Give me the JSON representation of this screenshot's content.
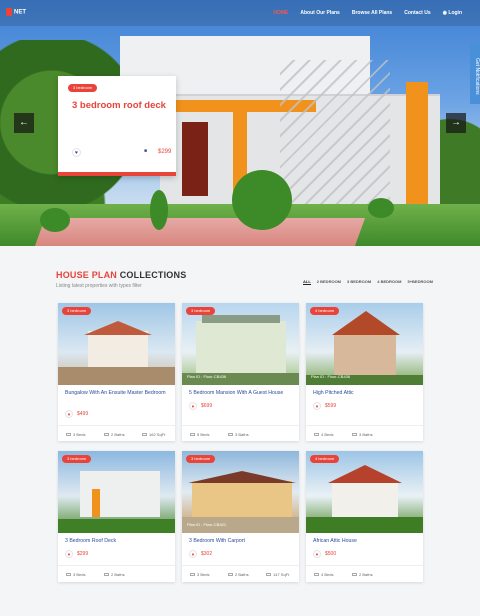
{
  "nav": {
    "logo": "NET",
    "links": [
      "HOME",
      "About Our Plans",
      "Browse All Plans",
      "Contact Us",
      "Login"
    ]
  },
  "side_tab": "Get Notifications",
  "hero": {
    "badge": "3 bedroom",
    "title": "3 bedroom roof deck",
    "price": "$299"
  },
  "section": {
    "title_red": "HOUSE PLAN",
    "title_rest": " COLLECTIONS",
    "subtitle": "Listing latest properties with types filter",
    "filters": [
      "ALL",
      "2 BEDROOM",
      "3 BEDROOM",
      "4 BEDROOM",
      "5+BEDROOM"
    ]
  },
  "cards": [
    {
      "badge": "3 bedroom",
      "plan_id": "",
      "title": "Bungalow With An Ensuite Master Bedroom",
      "price": "$499",
      "beds": "3 Beds",
      "baths": "2 Baths",
      "area": "162 SqFt"
    },
    {
      "badge": "3 bedroom",
      "plan_id": "Plan ID : Floor-CB436",
      "title": "5 Bedroom Mansion With A Guest House",
      "price": "$699",
      "beds": "5 Beds",
      "baths": "3 Baths",
      "area": ""
    },
    {
      "badge": "4 bedroom",
      "plan_id": "Plan ID : Floor-CB436",
      "title": "High Pitched Attic",
      "price": "$599",
      "beds": "4 Beds",
      "baths": "3 Baths",
      "area": ""
    },
    {
      "badge": "3 bedroom",
      "plan_id": "",
      "title": "3 Bedroom Roof Deck",
      "price": "$299",
      "beds": "3 Beds",
      "baths": "2 Baths",
      "area": ""
    },
    {
      "badge": "3 bedroom",
      "plan_id": "Plan ID : Floor-CB421",
      "title": "3 Bedroom With Carport",
      "price": "$302",
      "beds": "3 Beds",
      "baths": "2 Baths",
      "area": "147 SqFt"
    },
    {
      "badge": "4 bedroom",
      "plan_id": "",
      "title": "African Attic House",
      "price": "$500",
      "beds": "4 Beds",
      "baths": "2 Baths",
      "area": ""
    }
  ]
}
